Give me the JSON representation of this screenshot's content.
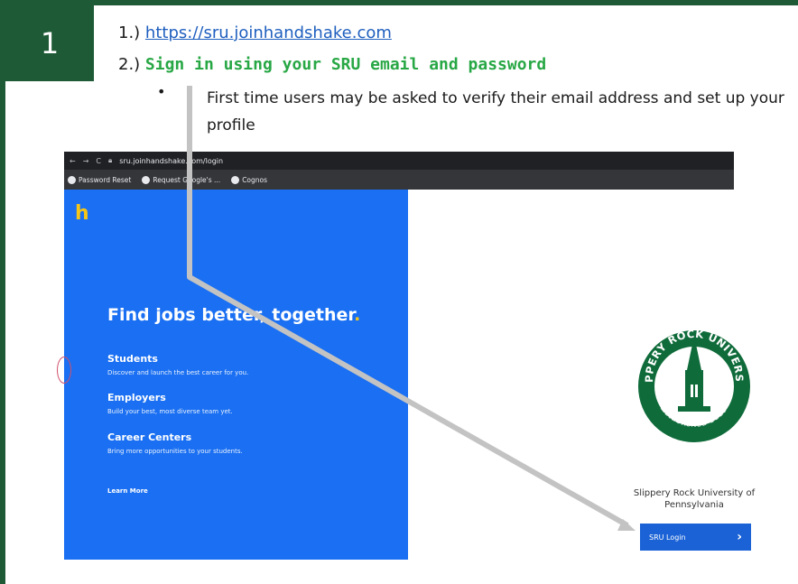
{
  "step_number": "1",
  "instructions": {
    "line1_prefix": "1.) ",
    "line1_link": "https://sru.joinhandshake.com",
    "line2_prefix": "2.) ",
    "line2_bold": "Sign in using your SRU email and password",
    "bullet": "First time users may be asked to verify their email address and set up your profile"
  },
  "browser": {
    "url": "sru.joinhandshake.com/login",
    "bookmarks": [
      "Password Reset",
      "Request Google's ...",
      "Cognos"
    ]
  },
  "handshake": {
    "logo": "h",
    "headline": "Find jobs better, together",
    "headline_dot": ".",
    "sections": [
      {
        "title": "Students",
        "desc": "Discover and launch the best career for you."
      },
      {
        "title": "Employers",
        "desc": "Build your best, most diverse team yet."
      },
      {
        "title": "Career Centers",
        "desc": "Bring more opportunities to your students."
      }
    ],
    "learn_more": "Learn More"
  },
  "university": {
    "seal_top": "SLIPPERY ROCK UNIVERSITY",
    "seal_bottom": "Established 1889",
    "name_line1": "Slippery Rock University of",
    "name_line2": "Pennsylvania",
    "login_button": "SRU Login",
    "login_chevron": "›"
  },
  "colors": {
    "frame_green": "#1e5a35",
    "instruction_green": "#28a745",
    "handshake_blue": "#1a6ff2",
    "sru_button_blue": "#1a62d6",
    "arrow_gray": "#c3c3c3"
  }
}
